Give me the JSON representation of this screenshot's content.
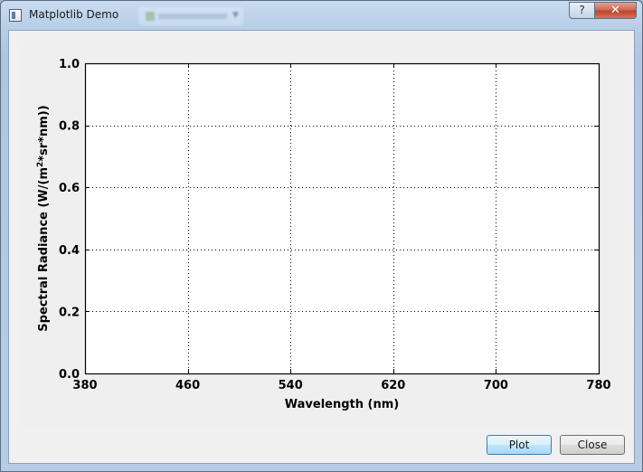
{
  "window": {
    "title": "Matplotlib Demo",
    "help_label": "?",
    "close_label": "✕"
  },
  "buttons": {
    "plot_label": "Plot",
    "close_label": "Close"
  },
  "chart_data": {
    "type": "line",
    "x": [],
    "series": [],
    "xlabel": "Wavelength (nm)",
    "ylabel_parts": [
      "Spectral Radiance (W/(m",
      "2",
      "*sr*nm))"
    ],
    "xlim": [
      380,
      780
    ],
    "ylim": [
      0.0,
      1.0
    ],
    "xticks": [
      "380",
      "460",
      "540",
      "620",
      "700",
      "780"
    ],
    "yticks": [
      "0.0",
      "0.2",
      "0.4",
      "0.6",
      "0.8",
      "1.0"
    ],
    "grid": true,
    "grid_style": "dotted",
    "colors": {
      "axes": "#000000",
      "grid": "#000000",
      "face": "#ffffff"
    }
  }
}
